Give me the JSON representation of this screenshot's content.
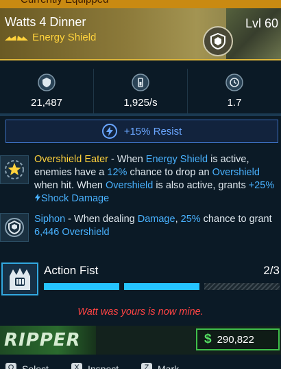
{
  "top_strip": {
    "label": "Currently Equipped"
  },
  "item": {
    "name": "Watts 4 Dinner",
    "type": "Energy Shield",
    "level": "Lvl 60"
  },
  "stats": [
    {
      "icon": "shield-capacity-icon",
      "value": "21,487"
    },
    {
      "icon": "recharge-rate-icon",
      "value": "1,925/s"
    },
    {
      "icon": "recharge-delay-icon",
      "value": "1.7"
    }
  ],
  "resist": {
    "icon": "shock-bolt-icon",
    "label": "+15% Resist"
  },
  "perks": {
    "overshield_eater": {
      "icon": "star-gear-icon",
      "name": "Overshield Eater",
      "p1": " - When ",
      "k1": "Energy Shield",
      "p2": " is active, enemies have a ",
      "k2": "12%",
      "p3": " chance to drop an ",
      "k3": "Overshield",
      "p4": " when hit. When ",
      "k4": "Overshield",
      "p5": " is also active, grants ",
      "k5": "+25%",
      "k6": "Shock Damage"
    },
    "siphon": {
      "icon": "siphon-shield-icon",
      "name": "Siphon",
      "p1": " - When dealing ",
      "k1": "Damage",
      "p2": ", ",
      "k2": "25%",
      "p3": " chance to grant ",
      "k3": "6,446 Overshield"
    }
  },
  "action_skill": {
    "icon": "action-fist-icon",
    "name": "Action Fist",
    "count": "2/3",
    "charges_filled": 2,
    "charges_total": 3
  },
  "flavor_text": "Watt was yours is now mine.",
  "manufacturer": {
    "logo_text": "RIPPER"
  },
  "price": {
    "symbol": "$",
    "amount": "290,822"
  },
  "prompts": [
    {
      "key": "Q",
      "label": "Select"
    },
    {
      "key": "X",
      "label": "Inspect"
    },
    {
      "key": "Z",
      "label": "Mark"
    }
  ],
  "colors": {
    "accent_gold": "#ffd23c",
    "keyword_blue": "#49b2ff",
    "flavor_red": "#ff4444",
    "price_green": "#55e063"
  }
}
